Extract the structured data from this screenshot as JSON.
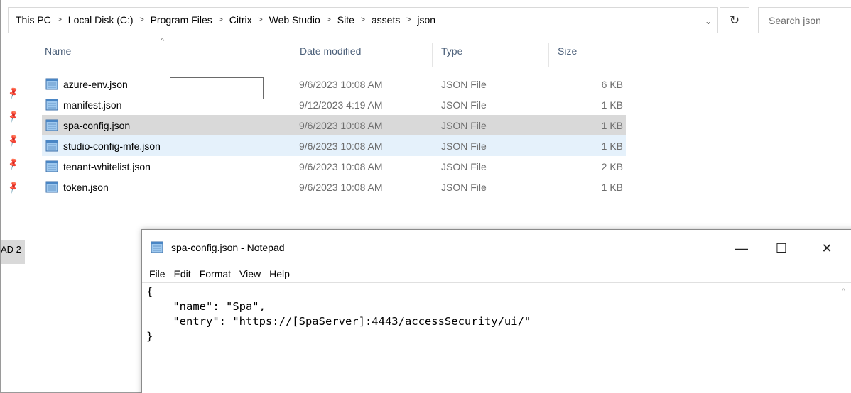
{
  "explorer": {
    "breadcrumbs": [
      "This PC",
      "Local Disk (C:)",
      "Program Files",
      "Citrix",
      "Web Studio",
      "Site",
      "assets",
      "json"
    ],
    "breadcrumb_separator": ">",
    "address_dropdown_glyph": "⌄",
    "refresh_glyph": "↻",
    "search_placeholder": "Search json",
    "nav_truncated_label": "AD 2",
    "columns": {
      "name": "Name",
      "date": "Date modified",
      "type": "Type",
      "size": "Size",
      "sort_glyph": "^"
    },
    "files": [
      {
        "name": "azure-env.json",
        "date": "9/6/2023 10:08 AM",
        "type": "JSON File",
        "size": "6 KB",
        "state": ""
      },
      {
        "name": "manifest.json",
        "date": "9/12/2023 4:19 AM",
        "type": "JSON File",
        "size": "1 KB",
        "state": ""
      },
      {
        "name": "spa-config.json",
        "date": "9/6/2023 10:08 AM",
        "type": "JSON File",
        "size": "1 KB",
        "state": "selected"
      },
      {
        "name": "studio-config-mfe.json",
        "date": "9/6/2023 10:08 AM",
        "type": "JSON File",
        "size": "1 KB",
        "state": "hover"
      },
      {
        "name": "tenant-whitelist.json",
        "date": "9/6/2023 10:08 AM",
        "type": "JSON File",
        "size": "2 KB",
        "state": ""
      },
      {
        "name": "token.json",
        "date": "9/6/2023 10:08 AM",
        "type": "JSON File",
        "size": "1 KB",
        "state": ""
      }
    ]
  },
  "notepad": {
    "title": "spa-config.json - Notepad",
    "menu": [
      "File",
      "Edit",
      "Format",
      "View",
      "Help"
    ],
    "buttons": {
      "minimize": "—",
      "maximize": "☐",
      "close": "✕"
    },
    "content": "{\n    \"name\": \"Spa\",\n    \"entry\": \"https://[SpaServer]:4443/accessSecurity/ui/\"\n}",
    "scroll_up_glyph": "^"
  },
  "colors": {
    "selected_row": "#d9d9d9",
    "hover_row": "#e5f1fb",
    "header_text": "#4c607a",
    "secondary_text": "#6d6d6d"
  },
  "icons": {
    "file": "notepad-document-icon",
    "pin": "pin-icon"
  }
}
